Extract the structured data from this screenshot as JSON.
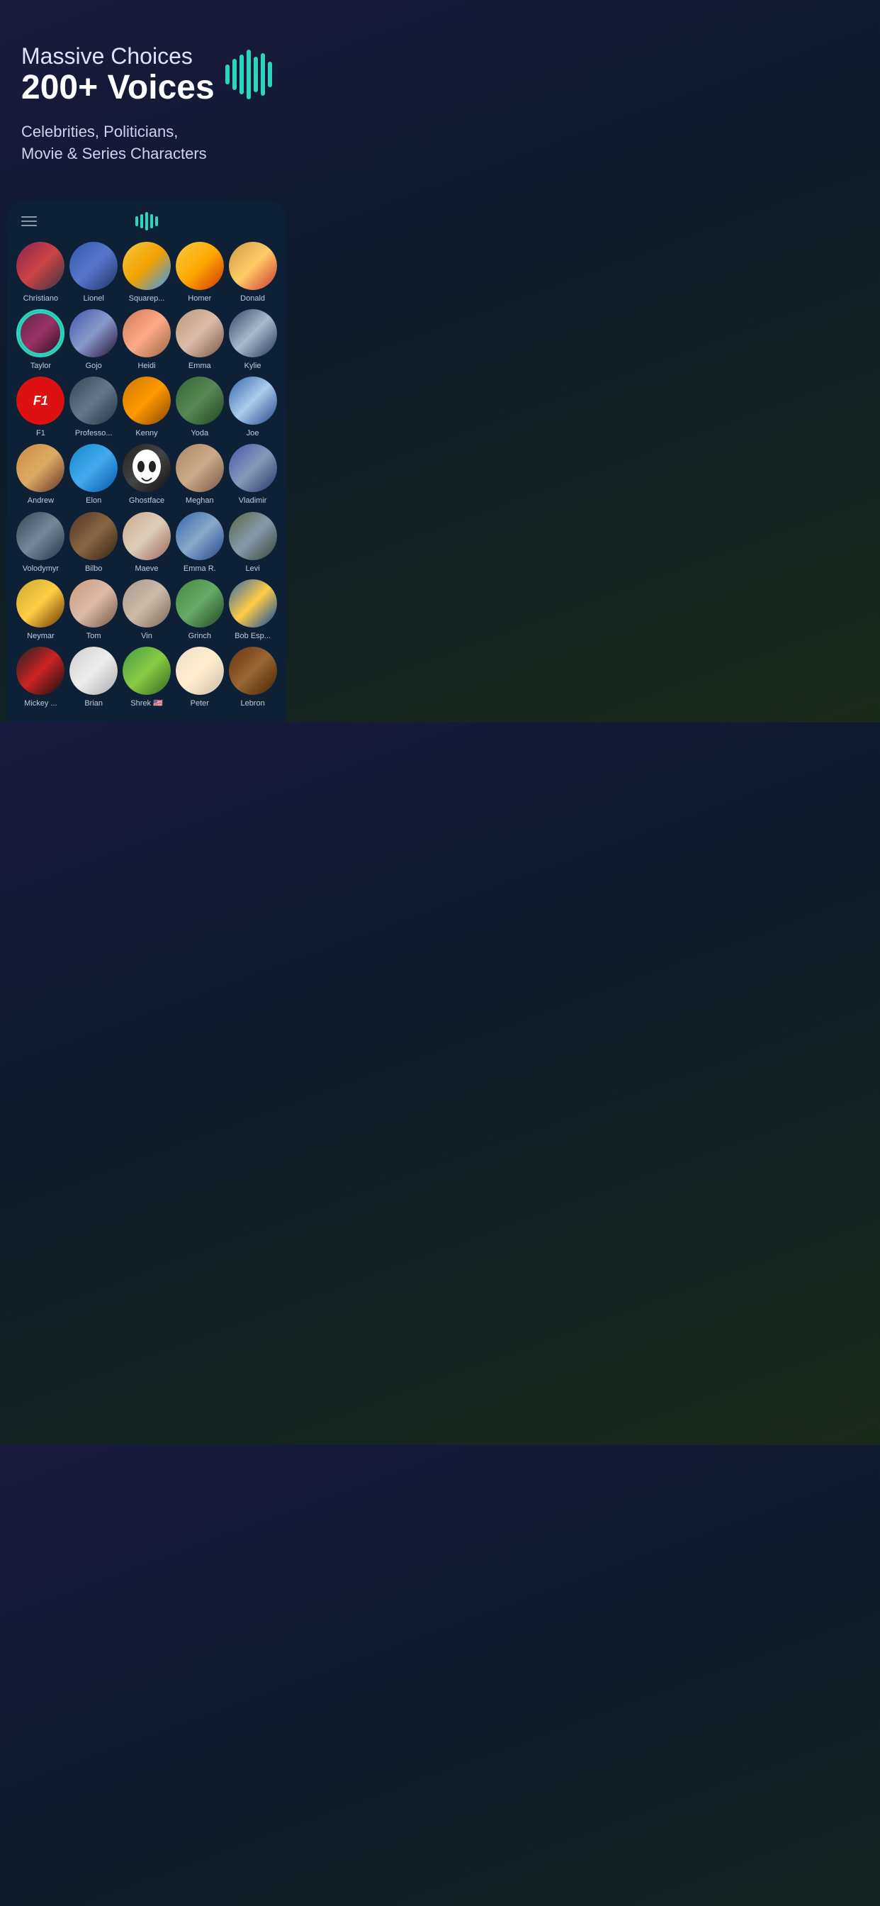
{
  "header": {
    "subtitle": "Massive Choices",
    "title": "200+ Voices",
    "description_line1": "Celebrities, Politicians,",
    "description_line2": "Movie  & Series Characters"
  },
  "waveform": {
    "bars": [
      30,
      50,
      70,
      90,
      60,
      80,
      45
    ]
  },
  "app": {
    "menu_label": "menu",
    "wave_label": "sound wave"
  },
  "voices": [
    {
      "id": "christiano",
      "name": "Christiano",
      "avatar_class": "av-christiano"
    },
    {
      "id": "lionel",
      "name": "Lionel",
      "avatar_class": "av-lionel"
    },
    {
      "id": "squarep",
      "name": "Squarep...",
      "avatar_class": "av-squarep"
    },
    {
      "id": "homer",
      "name": "Homer",
      "avatar_class": "av-homer"
    },
    {
      "id": "donald",
      "name": "Donald",
      "avatar_class": "av-donald"
    },
    {
      "id": "taylor",
      "name": "Taylor",
      "avatar_class": "av-taylor"
    },
    {
      "id": "gojo",
      "name": "Gojo",
      "avatar_class": "av-gojo"
    },
    {
      "id": "heidi",
      "name": "Heidi",
      "avatar_class": "av-heidi"
    },
    {
      "id": "emma",
      "name": "Emma",
      "avatar_class": "av-emma"
    },
    {
      "id": "kylie",
      "name": "Kylie",
      "avatar_class": "av-kylie"
    },
    {
      "id": "f1",
      "name": "F1",
      "avatar_class": "av-f1"
    },
    {
      "id": "professor",
      "name": "Professo...",
      "avatar_class": "av-professor"
    },
    {
      "id": "kenny",
      "name": "Kenny",
      "avatar_class": "av-kenny"
    },
    {
      "id": "yoda",
      "name": "Yoda",
      "avatar_class": "av-yoda"
    },
    {
      "id": "joe",
      "name": "Joe",
      "avatar_class": "av-joe"
    },
    {
      "id": "andrew",
      "name": "Andrew",
      "avatar_class": "av-andrew"
    },
    {
      "id": "elon",
      "name": "Elon",
      "avatar_class": "av-elon"
    },
    {
      "id": "ghostface",
      "name": "Ghostface",
      "avatar_class": "av-ghostface"
    },
    {
      "id": "meghan",
      "name": "Meghan",
      "avatar_class": "av-meghan"
    },
    {
      "id": "vladimir",
      "name": "Vladimir",
      "avatar_class": "av-vladimir"
    },
    {
      "id": "volodymyr",
      "name": "Volodymyr",
      "avatar_class": "av-volodymyr"
    },
    {
      "id": "bilbo",
      "name": "Bilbo",
      "avatar_class": "av-bilbo"
    },
    {
      "id": "maeve",
      "name": "Maeve",
      "avatar_class": "av-maeve"
    },
    {
      "id": "emmar",
      "name": "Emma R.",
      "avatar_class": "av-emmar"
    },
    {
      "id": "levi",
      "name": "Levi",
      "avatar_class": "av-levi"
    },
    {
      "id": "neymar",
      "name": "Neymar",
      "avatar_class": "av-neymar"
    },
    {
      "id": "tom",
      "name": "Tom",
      "avatar_class": "av-tom"
    },
    {
      "id": "vin",
      "name": "Vin",
      "avatar_class": "av-vin"
    },
    {
      "id": "grinch",
      "name": "Grinch",
      "avatar_class": "av-grinch"
    },
    {
      "id": "bobesp",
      "name": "Bob Esp...",
      "avatar_class": "av-bobesp"
    },
    {
      "id": "mickey",
      "name": "Mickey ...",
      "avatar_class": "av-mickey"
    },
    {
      "id": "brian",
      "name": "Brian",
      "avatar_class": "av-brian"
    },
    {
      "id": "shrek",
      "name": "Shrek 🇺🇸",
      "avatar_class": "av-shrek"
    },
    {
      "id": "peter",
      "name": "Peter",
      "avatar_class": "av-peter"
    },
    {
      "id": "lebron",
      "name": "Lebron",
      "avatar_class": "av-lebron"
    }
  ]
}
